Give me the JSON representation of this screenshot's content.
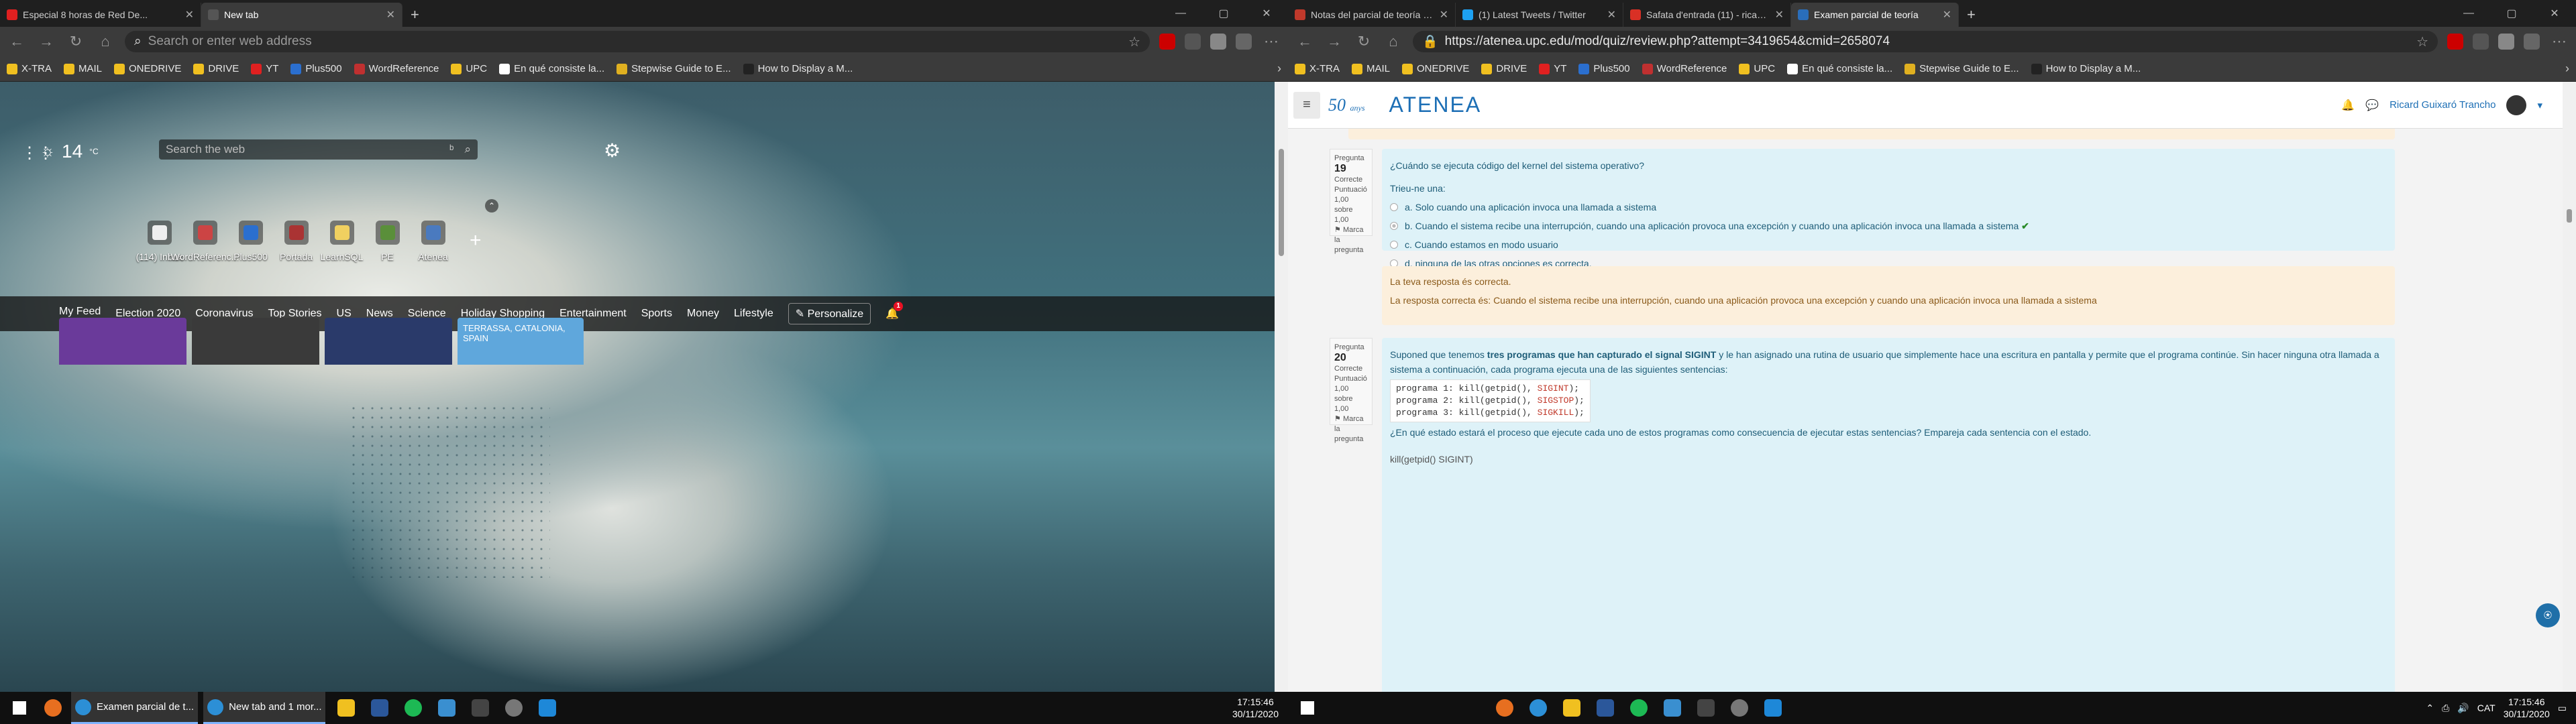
{
  "left": {
    "tabs": [
      {
        "label": "Especial 8 horas de Red De...",
        "color": "#e02020"
      },
      {
        "label": "New tab",
        "color": "#555555"
      }
    ],
    "address_placeholder": "Search or enter web address",
    "bookmarks": [
      "X-TRA",
      "MAIL",
      "ONEDRIVE",
      "DRIVE",
      "YT",
      "Plus500",
      "WordReference",
      "UPC",
      "En qué consiste la...",
      "Stepwise Guide to E...",
      "How to Display a M..."
    ],
    "weather": {
      "temp": "14",
      "unit": "°C"
    },
    "search_placeholder": "Search the web",
    "tiles": [
      "(114) Inbox",
      "WordReferenc...",
      "Plus500",
      "Portada",
      "LearnSQL",
      "PE",
      "Atenea"
    ],
    "feed_nav": [
      "My Feed",
      "Election 2020",
      "Coronavirus",
      "Top Stories",
      "US",
      "News",
      "Science",
      "Holiday Shopping",
      "Entertainment",
      "Sports",
      "Money",
      "Lifestyle"
    ],
    "personalize": "Personalize",
    "notif_count": "1",
    "weather_card": "TERRASSA, CATALONIA, SPAIN",
    "taskbar_windows": [
      "Examen parcial de t...",
      "New tab and 1 mor..."
    ],
    "clock": {
      "time": "17:15:46",
      "date": "30/11/2020"
    }
  },
  "right": {
    "tabs": [
      {
        "label": "Notas del parcial de teoría - Ra...",
        "color": "#c0392b"
      },
      {
        "label": "(1) Latest Tweets / Twitter",
        "color": "#1da1f2"
      },
      {
        "label": "Safata d'entrada (11) - ricard.gu...",
        "color": "#d93025"
      },
      {
        "label": "Examen parcial de teoría",
        "color": "#2a6ebb"
      }
    ],
    "url": "https://atenea.upc.edu/mod/quiz/review.php?attempt=3419654&cmid=2658074",
    "bookmarks": [
      "X-TRA",
      "MAIL",
      "ONEDRIVE",
      "DRIVE",
      "YT",
      "Plus500",
      "WordReference",
      "UPC",
      "En qué consiste la...",
      "Stepwise Guide to E...",
      "How to Display a M..."
    ],
    "site": {
      "logo_50": "50",
      "logo_sub": "anys",
      "logo_name": "ATENEA",
      "user": "Ricard Guixaró Trancho"
    },
    "q19": {
      "label": "Pregunta",
      "num": "19",
      "state": "Correcte",
      "score": "Puntuació 1,00 sobre 1,00",
      "flag": "Marca la pregunta",
      "text": "¿Cuándo se ejecuta código del kernel del sistema operativo?",
      "prompt": "Trieu-ne una:",
      "options": [
        "a. Solo cuando una aplicación invoca una llamada a sistema",
        "b. Cuando el sistema recibe una interrupción, cuando una aplicación provoca una excepción y cuando una aplicación invoca una llamada a sistema",
        "c. Cuando estamos en modo usuario",
        "d. ninguna de las otras opciones es correcta."
      ],
      "feedback1": "La teva resposta és correcta.",
      "feedback2": "La resposta correcta és: Cuando el sistema recibe una interrupción, cuando una aplicación provoca una excepción y cuando una aplicación invoca una llamada a sistema"
    },
    "q20": {
      "label": "Pregunta",
      "num": "20",
      "state": "Correcte",
      "score": "Puntuació 1,00 sobre 1,00",
      "flag": "Marca la pregunta",
      "text_a": "Suponed que tenemos",
      "text_b": "tres programas que han capturado el signal SIGINT",
      "text_c": "y le han asignado una rutina de usuario que simplemente hace una escritura en pantalla y permite que el programa continúe. Sin hacer ninguna otra llamada a sistema a continuación, cada programa ejecuta una de las siguientes sentencias:",
      "code": [
        {
          "prefix": "programa 1: kill(getpid(), ",
          "sig": "SIGINT",
          "suffix": ");"
        },
        {
          "prefix": "programa 2: kill(getpid(), ",
          "sig": "SIGSTOP",
          "suffix": ");"
        },
        {
          "prefix": "programa 3: kill(getpid(), ",
          "sig": "SIGKILL",
          "suffix": ");"
        }
      ],
      "question": "¿En qué estado estará el proceso que ejecute cada uno de estos programas como consecuencia de ejecutar estas sentencias? Empareja cada sentencia con el estado.",
      "match_first": "kill(getpid() SIGINT)"
    },
    "taskbar_clock": {
      "time": "17:15:46",
      "date": "30/11/2020",
      "lang": "CAT"
    }
  },
  "colors": {
    "accent": "#1d6fb5",
    "qbox": "#def2f8",
    "feedback": "#fcefdc",
    "correct": "#2a8b2a"
  }
}
